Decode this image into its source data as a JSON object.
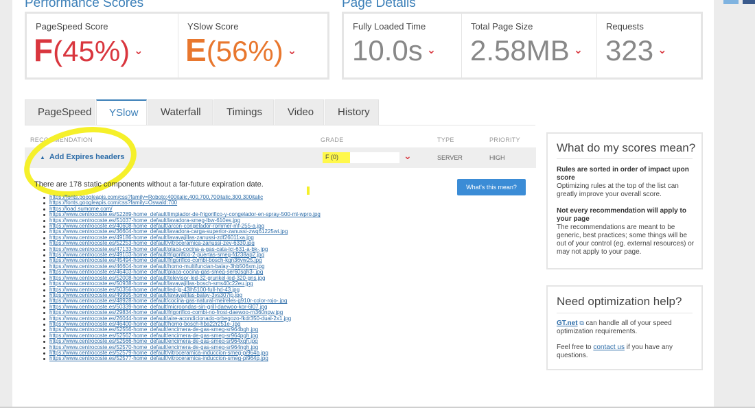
{
  "colors": {
    "accent": "#3b7fb8",
    "grade_f": "#d9363e",
    "grade_e": "#e8772e",
    "highlight": "#f5f02a",
    "button": "#3b8cd6"
  },
  "sections": {
    "performance_title": "Performance Scores",
    "page_details_title": "Page Details"
  },
  "scores": {
    "pagespeed": {
      "label": "PageSpeed Score",
      "letter": "F",
      "pct": "(45%)"
    },
    "yslow": {
      "label": "YSlow Score",
      "letter": "E",
      "pct": "(56%)"
    }
  },
  "details": {
    "loaded": {
      "label": "Fully Loaded Time",
      "value": "10.0s"
    },
    "size": {
      "label": "Total Page Size",
      "value": "2.58MB"
    },
    "requests": {
      "label": "Requests",
      "value": "323"
    }
  },
  "tabs": [
    "PageSpeed",
    "YSlow",
    "Waterfall",
    "Timings",
    "Video",
    "History"
  ],
  "table": {
    "headers": {
      "recommendation": "RECOMMENDATION",
      "grade": "GRADE",
      "type": "TYPE",
      "priority": "PRIORITY"
    },
    "row": {
      "name": "Add Expires headers",
      "grade": "F (0)",
      "grade_fraction": 0.36,
      "type": "SERVER",
      "priority": "HIGH"
    }
  },
  "description": "There are 178 static components without a far-future expiration date.",
  "whats_button": "What's this mean?",
  "urls": [
    "https://fonts.googleapis.com/css?family=Roboto:400italic,400,700,700italic,300,300italic",
    "https://fonts.googleapis.com/css?family=Oswald:700",
    "https://load.sumome.com/",
    "https://www.centrocoste.es/52289-home_default/limpiador-de-frigorifico-y-congelador-en-spray-500-ml-wpro.jpg",
    "https://www.centrocoste.es/51037-home_default/lavadora-smeg-lbw-610es.jpg",
    "https://www.centrocoste.es/40608-home_default/arcon-congelador-rommer-mf-255-a.jpg",
    "https://www.centrocoste.es/36604-home_default/lavadora-carga-superior-zanussi-zwq61225wi.jpg",
    "https://www.centrocoste.es/49186-home_default/lavavajillas-zanussi-zdf26011xa.jpg",
    "https://www.centrocoste.es/52253-home_default/vitroceramica-zanussi-zev-6330.jpg",
    "https://www.centrocoste.es/47133-home_default/placa-cocina-a-gas-cata-lci-631-a-bk-.jpg",
    "https://www.centrocoste.es/49103-home_default/frigorifico-2-puertas-smeg-fd238ap2.jpg",
    "https://www.centrocoste.es/45494-home_default/frigorifico-combi-bosch-kgn36vw25.jpg",
    "https://www.centrocoste.es/46604-home_default/horno-multifuncian-balay-3hb506xm.jpg",
    "https://www.centrocoste.es/46403-home_default/placa-cocina-gas-smeg-ser60sgh3-.jpg",
    "https://www.centrocoste.es/52008-home_default/televisor-led-32-grunkel-led-320-gns.jpg",
    "https://www.centrocoste.es/50938-home_default/lavavajillas-bosch-sms40c22eu.jpg",
    "https://www.centrocoste.es/50356-home_default/led-lg-43lh5100-full-hd-43.jpg",
    "https://www.centrocoste.es/49995-home_default/lavavajillas-balay-3vs307ip.jpg",
    "https://www.centrocoste.es/48928-home_default/cocina-gas-natural-meireles-g910r-color-rojo-.jpg",
    "https://www.centrocoste.es/50339-home_default/microondas-sin-grill-daewoo-kor-6l07.jpg",
    "https://www.centrocoste.es/29834-home_default/frigorifico-combi-no-frost-daewoo-rn360npw.jpg",
    "https://www.centrocoste.es/26044-home_default/aire-acondicionado-orbegozo-fkdr350-dual-2x1.jpg",
    "https://www.centrocoste.es/46400-home_default/horno-bosch-hba22r251e-.jpg",
    "https://www.centrocoste.es/52556-home_default/encimera-de-gas-smeg-sr964bgh.jpg",
    "https://www.centrocoste.es/52562-home_default/encimera-de-gas-smeg-sr964pgh.jpg",
    "https://www.centrocoste.es/52566-home_default/encimera-de-gas-smeg-sr964xgh.jpg",
    "https://www.centrocoste.es/52570-home_default/encimera-de-gas-smeg-sr964ngh.jpg",
    "https://www.centrocoste.es/52579-home_default/vitroceramica-induccion-smeg-pi964b.jpg",
    "https://www.centrocoste.es/52577-home_default/vitroceramica-induccion-smeg-pi964p.jpg"
  ],
  "sidebar": {
    "scores_box": {
      "title": "What do my scores mean?",
      "p1_bold": "Rules are sorted in order of impact upon score",
      "p1_text": "Optimizing rules at the top of the list can greatly improve your overall score.",
      "p2_bold": "Not every recommendation will apply to your page",
      "p2_text": "The recommendations are meant to be generic, best practices; some things will be out of your control (eg. external resources) or may not apply to your page."
    },
    "help_box": {
      "title": "Need optimization help?",
      "gtnet_link": "GT.net",
      "gtnet_text": " can handle all of your speed optimization requirements.",
      "feel_free": "Feel free to ",
      "contact_link": "contact us",
      "contact_rest": " if you have any questions."
    }
  }
}
